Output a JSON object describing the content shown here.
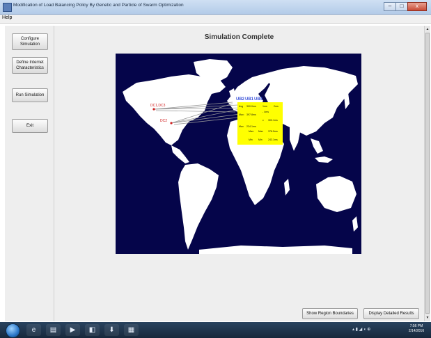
{
  "window": {
    "title": "Modification of Load Balancing Policy By Genetic and Particle of Swarm Optimization",
    "minimize": "–",
    "maximize": "□",
    "close": "x"
  },
  "menu": {
    "help": "Help"
  },
  "sidebar": {
    "configure": "Configure Simulation",
    "define_internet": "Define Internet Characteristics",
    "run": "Run Simulation",
    "exit": "Exit"
  },
  "main": {
    "title": "Simulation Complete",
    "show_regions": "Show Region Boundaries",
    "display_results": "Display Detailed Results"
  },
  "map": {
    "dc_labels": [
      "DC1,DC3",
      "DC2"
    ],
    "userbase_labels": [
      "UB2",
      "UB1",
      "UB4"
    ],
    "stats": {
      "row1": [
        "Avg",
        "300.0ms",
        "1ms",
        "2ms"
      ],
      "row2": [
        "Max:",
        "397.8ms",
        "- 4ms"
      ],
      "row3": [
        "c",
        "300.1ms"
      ],
      "row4": [
        "Max",
        "234.1ms",
        "Max:",
        "Max",
        "378.5ms"
      ],
      "row5": [
        "Min",
        "Min",
        "243.1ms"
      ]
    }
  },
  "scroll": {
    "up": "▲",
    "down": "▼"
  },
  "taskbar": {
    "items": [
      "e",
      "▤",
      "▶",
      "◧",
      "⬇",
      "▦"
    ],
    "tray": "▴ ▮ ◢ ◖ ⊕",
    "time": "7:56 PM",
    "date": "2/14/2016"
  }
}
